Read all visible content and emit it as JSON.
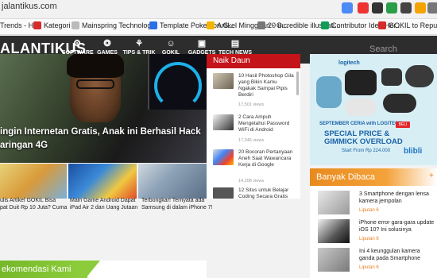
{
  "browser": {
    "url": "jalantikus.com",
    "bookmarks": [
      {
        "label": "Trends - Hot"
      },
      {
        "label": "Kategori"
      },
      {
        "label": "Mainspring Technolog..."
      },
      {
        "label": "Template Pokemon G..."
      },
      {
        "label": "Artikel Mingguan - G..."
      },
      {
        "label": "20 incredible illustrati..."
      },
      {
        "label": "Contributor Idea Her..."
      },
      {
        "label": "GOKIL to Repub - Go..."
      }
    ]
  },
  "nav": {
    "logo": "ALANTIKUS",
    "items": [
      {
        "label": "SOFTWARE",
        "icon": "⚙",
        "color": "#e8192c"
      },
      {
        "label": "GAMES",
        "icon": "❂",
        "color": "#f7a600"
      },
      {
        "label": "TIPS & TRIK",
        "icon": "⚘",
        "color": "#2d8cd8"
      },
      {
        "label": "GOKIL",
        "icon": "☺",
        "color": "#8fbe2d"
      },
      {
        "label": "GADGETS",
        "icon": "▣",
        "color": "#e8192c"
      },
      {
        "label": "TECH NEWS",
        "icon": "▤",
        "color": "#8fbe2d"
      }
    ],
    "search_placeholder": "Search JalanTikus..."
  },
  "hero": {
    "title_line1": "ingin Internetan Gratis, Anak ini Berhasil Hack",
    "title_line2": "aringan 4G"
  },
  "thumbs": [
    {
      "caption": "ulis Artikel GOKIL Bisa\npat Duit Rp 10 Juta? Cuma"
    },
    {
      "caption": "Main Game Android Dapat\niPad Air 2 dan Uang Jutaan"
    },
    {
      "caption": "Terbongkar! Ternyata ada\nSamsung di dalam iPhone 7!"
    }
  ],
  "naik_daun": {
    "header": "Naik Daun",
    "items": [
      {
        "title": "10 Hasil Photoshop Gila yang Bikin Kamu Ngakak Sampai Pipis Berdiri",
        "views": "17,501 views"
      },
      {
        "title": "2 Cara Ampuh Mengetahui Password WiFi di Android",
        "views": "17,346 views"
      },
      {
        "title": "20 Bocoran Pertanyaan Aneh Saat Wawancara Kerja di Google",
        "views": "14,208 views"
      },
      {
        "title": "12 Situs untuk Belajar Coding Secara Gratis",
        "views": ""
      }
    ]
  },
  "ad": {
    "brand": "logitech",
    "promo": "SEPTEMBER CERIA with LOGITECH",
    "special_line1": "SPECIAL PRICE &",
    "special_line2": "GIMMICK OVERLOAD",
    "price": "Start From Rp 224.000",
    "cta": "BELI",
    "store": "blibli"
  },
  "banyak": {
    "header": "Banyak Dibaca",
    "items": [
      {
        "title": "3 Smartphone dengan lensa kamera jempolan",
        "source": "Liputan 6"
      },
      {
        "title": "iPhone error gara-gara update iOS 10? Ini solusinya",
        "source": "Liputan 6"
      },
      {
        "title": "Ini 4 keunggulan kamera ganda pada Smartphone",
        "source": "Liputan 6"
      }
    ]
  },
  "rekomendasi": {
    "header": "ekomendasi Kami"
  }
}
